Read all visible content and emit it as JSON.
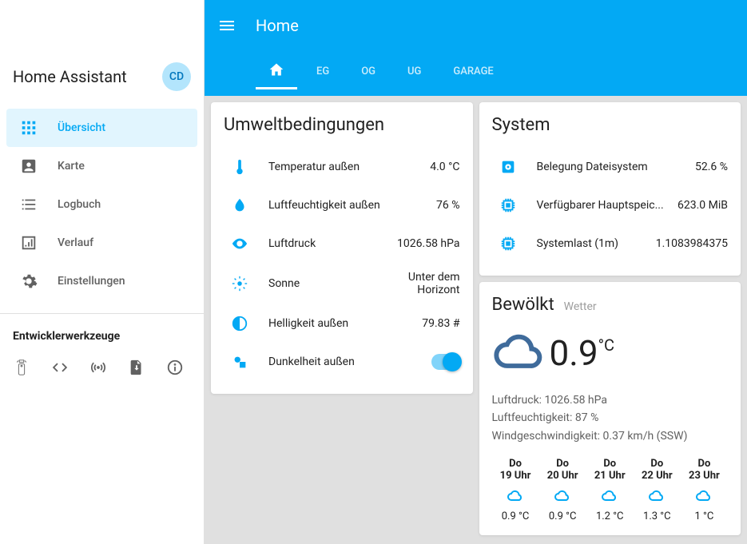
{
  "sidebar": {
    "title": "Home Assistant",
    "avatar": "CD",
    "items": [
      {
        "label": "Übersicht"
      },
      {
        "label": "Karte"
      },
      {
        "label": "Logbuch"
      },
      {
        "label": "Verlauf"
      },
      {
        "label": "Einstellungen"
      }
    ],
    "dev_title": "Entwicklerwerkzeuge"
  },
  "header": {
    "title": "Home",
    "tabs": [
      "EG",
      "OG",
      "UG",
      "GARAGE"
    ]
  },
  "env_card": {
    "title": "Umweltbedingungen",
    "rows": [
      {
        "label": "Temperatur außen",
        "value": "4.0 °C"
      },
      {
        "label": "Luftfeuchtigkeit außen",
        "value": "76 %"
      },
      {
        "label": "Luftdruck",
        "value": "1026.58 hPa"
      },
      {
        "label": "Sonne",
        "value": "Unter dem Horizont"
      },
      {
        "label": "Helligkeit außen",
        "value": "79.83 #"
      },
      {
        "label": "Dunkelheit außen",
        "value": ""
      }
    ]
  },
  "system_card": {
    "title": "System",
    "rows": [
      {
        "label": "Belegung Dateisystem",
        "value": "52.6 %"
      },
      {
        "label": "Verfügbarer Hauptspeic...",
        "value": "623.0 MiB"
      },
      {
        "label": "Systemlast (1m)",
        "value": "1.1083984375"
      }
    ]
  },
  "weather": {
    "title": "Bewölkt",
    "subtitle": "Wetter",
    "temp": "0.9",
    "unit": "°C",
    "pressure": "Luftdruck: 1026.58 hPa",
    "humidity": "Luftfeuchtigkeit: 87 %",
    "wind": "Windgeschwindigkeit: 0.37 km/h (SSW)",
    "forecast": [
      {
        "day": "Do",
        "time": "19 Uhr",
        "temp": "0.9 °C"
      },
      {
        "day": "Do",
        "time": "20 Uhr",
        "temp": "0.9 °C"
      },
      {
        "day": "Do",
        "time": "21 Uhr",
        "temp": "1.2 °C"
      },
      {
        "day": "Do",
        "time": "22 Uhr",
        "temp": "1.3 °C"
      },
      {
        "day": "Do",
        "time": "23 Uhr",
        "temp": "1 °C"
      }
    ]
  }
}
